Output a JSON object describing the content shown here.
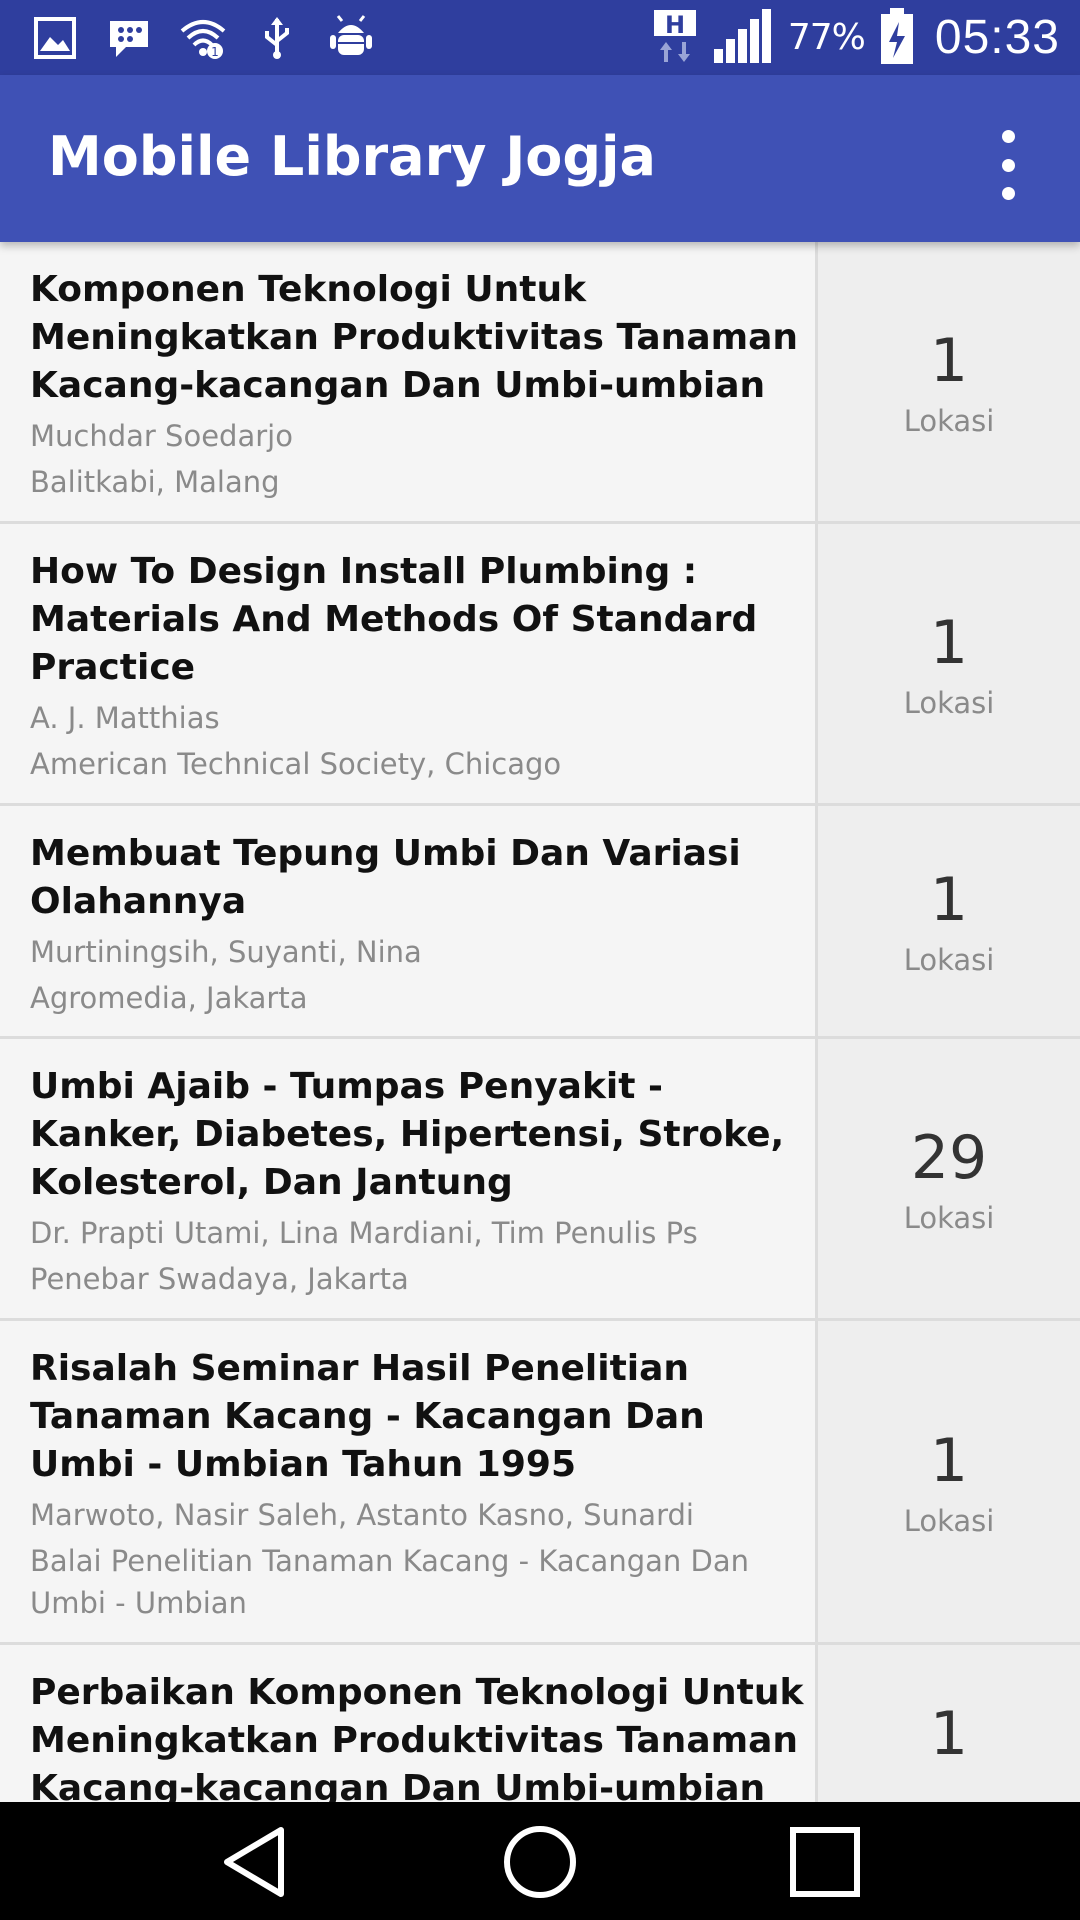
{
  "status_bar": {
    "icons": [
      "image-icon",
      "bbm-chat-icon",
      "wifi-icon",
      "usb-icon",
      "android-debug-icon"
    ],
    "network_label": "H",
    "battery_percent": "77%",
    "time": "05:33"
  },
  "app_bar": {
    "title": "Mobile Library Jogja",
    "overflow_icon": "more-vert-icon"
  },
  "books": [
    {
      "title": "Komponen Teknologi Untuk Meningkatkan Produktivitas Tanaman Kacang-kacangan Dan Umbi-umbian",
      "authors": "Muchdar Soedarjo",
      "publisher": "Balitkabi, Malang",
      "count": "1",
      "count_label": "Lokasi"
    },
    {
      "title": "How To Design Install Plumbing : Materials And Methods Of Standard Practice",
      "authors": "A. J. Matthias",
      "publisher": "American Technical Society, Chicago",
      "count": "1",
      "count_label": "Lokasi"
    },
    {
      "title": "Membuat Tepung Umbi Dan Variasi Olahannya",
      "authors": "Murtiningsih, Suyanti, Nina",
      "publisher": "Agromedia, Jakarta",
      "count": "1",
      "count_label": "Lokasi"
    },
    {
      "title": "Umbi Ajaib - Tumpas Penyakit - Kanker, Diabetes, Hipertensi, Stroke, Kolesterol, Dan Jantung",
      "authors": "Dr. Prapti Utami, Lina Mardiani, Tim Penulis Ps",
      "publisher": "Penebar Swadaya, Jakarta",
      "count": "29",
      "count_label": "Lokasi"
    },
    {
      "title": "Risalah Seminar Hasil Penelitian Tanaman Kacang - Kacangan Dan Umbi - Umbian Tahun 1995",
      "authors": "Marwoto, Nasir Saleh, Astanto Kasno, Sunardi",
      "publisher": "Balai Penelitian Tanaman Kacang - Kacangan Dan Umbi - Umbian",
      "count": "1",
      "count_label": "Lokasi"
    },
    {
      "title": "Perbaikan Komponen Teknologi Untuk Meningkatkan Produktivitas Tanaman Kacang-kacangan Dan Umbi-umbian",
      "authors": "",
      "publisher": "",
      "count": "1",
      "count_label": ""
    }
  ],
  "nav_bar": {
    "back_icon": "back-triangle-icon",
    "home_icon": "home-circle-icon",
    "recents_icon": "recents-square-icon"
  },
  "colors": {
    "status_bar": "#2f3e9e",
    "app_bar": "#3f51b5",
    "row_bg": "#f5f5f5",
    "side_bg": "#eeeeee"
  }
}
